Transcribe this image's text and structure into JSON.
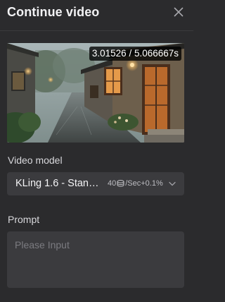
{
  "dialog": {
    "title": "Continue video",
    "close_icon": "close-icon"
  },
  "preview": {
    "timecode": "3.01526 / 5.066667s",
    "image_description": "rainy cobblestone alley"
  },
  "video_model": {
    "label": "Video model",
    "selected": "KLing 1.6 - Standard",
    "cost_prefix": "40",
    "cost_icon": "coin-icon",
    "cost_suffix": "/Sec+0.1%",
    "chevron_icon": "chevron-down-icon"
  },
  "prompt": {
    "label": "Prompt",
    "placeholder": "Please Input",
    "value": ""
  },
  "colors": {
    "background": "#2b2b2d",
    "field": "#3b3b3e",
    "text": "#e8e8ea",
    "muted": "#7b7b80"
  }
}
